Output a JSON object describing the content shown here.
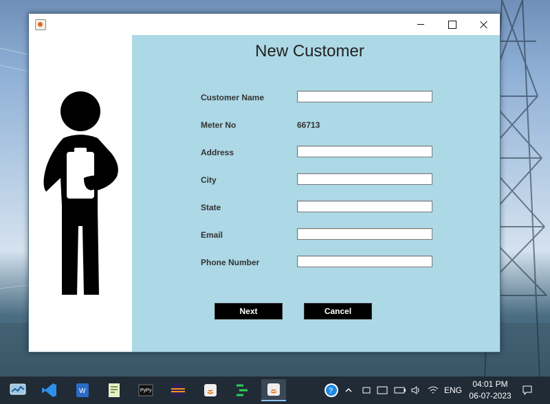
{
  "window": {
    "controls": {
      "minimize": "minimize",
      "maximize": "maximize",
      "close": "close"
    }
  },
  "form": {
    "title": "New Customer",
    "fields": [
      {
        "label": "Customer Name",
        "value": "",
        "type": "input"
      },
      {
        "label": "Meter No",
        "value": "66713",
        "type": "text"
      },
      {
        "label": "Address",
        "value": "",
        "type": "input"
      },
      {
        "label": "City",
        "value": "",
        "type": "input"
      },
      {
        "label": "State",
        "value": "",
        "type": "input"
      },
      {
        "label": "Email",
        "value": "",
        "type": "input"
      },
      {
        "label": "Phone Number",
        "value": "",
        "type": "input"
      }
    ],
    "buttons": {
      "next": "Next",
      "cancel": "Cancel"
    }
  },
  "taskbar": {
    "apps": [
      "task-manager-icon",
      "vscode-icon",
      "word-icon",
      "notepad-icon",
      "pycharm-icon",
      "eclipse-icon",
      "java-icon",
      "green-app-icon",
      "java-active-icon"
    ],
    "tray": {
      "language": "ENG",
      "time": "04:01 PM",
      "date": "06-07-2023"
    }
  },
  "colors": {
    "form_bg": "#add8e6",
    "button_bg": "#000000",
    "taskbar_bg": "#202b36"
  }
}
